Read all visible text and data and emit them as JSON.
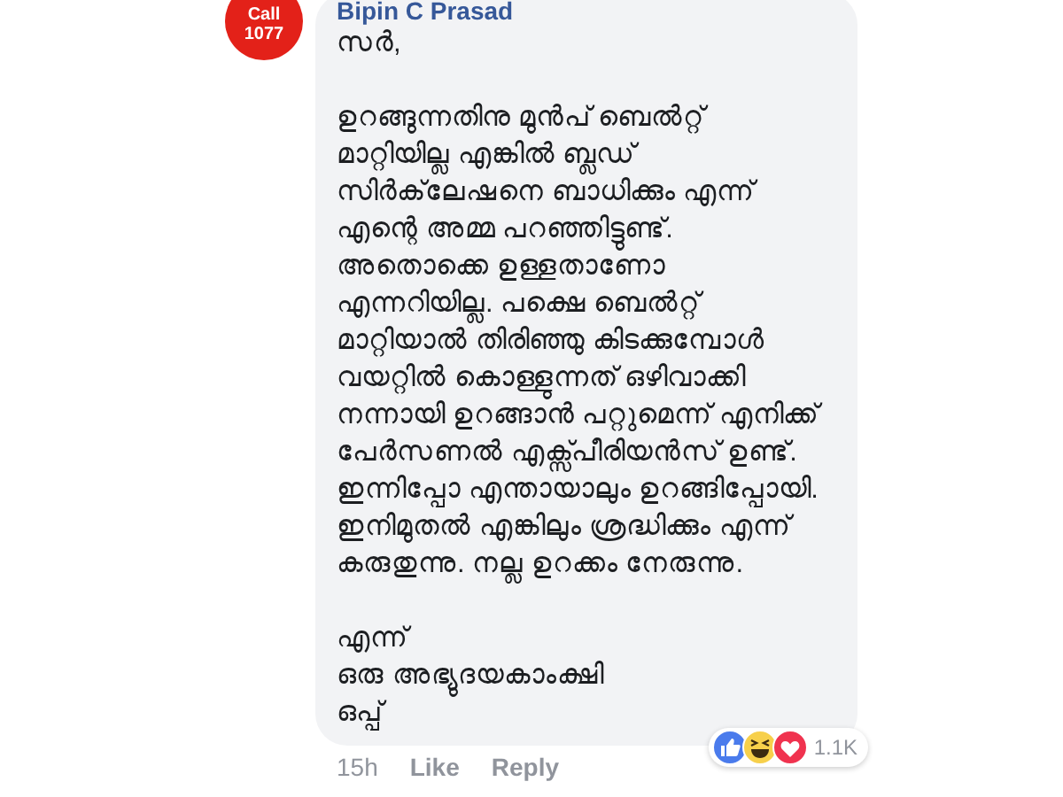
{
  "avatar": {
    "lines": [
      "Call",
      "1077"
    ]
  },
  "comment": {
    "author": "Bipin C Prasad",
    "paragraphs": [
      "സർ,",
      "ഉറങ്ങുന്നതിനു മുൻപ് ബെൽറ്റ്\nമാറ്റിയില്ല എങ്കിൽ ബ്ലഡ്\nസിർക്‌ലേഷനെ ബാധിക്കും എന്ന്\nഎന്റെ അമ്മ പറഞ്ഞിട്ടുണ്ട്.\nഅതൊക്കെ ഉള്ളതാണോ\nഎന്നറിയില്ല. പക്ഷെ ബെൽറ്റ്\nമാറ്റിയാൽ തിരിഞ്ഞു കിടക്കുമ്പോൾ\nവയറ്റിൽ കൊള്ളുന്നത് ഒഴിവാക്കി\nനന്നായി ഉറങ്ങാൻ പറ്റുമെന്ന് എനിക്ക്\nപേർസണൽ എക്സ്പീരിയൻസ് ഉണ്ട്.\nഇന്നിപ്പോ എന്തായാലും ഉറങ്ങിപ്പോയി.\nഇനിമുതൽ എങ്കിലും ശ്രദ്ധിക്കും എന്ന്\nകരുതുന്നു. നല്ല ഉറക്കം നേരുന്നു.",
      "എന്ന്\nഒരു അഭ്യുദയകാംക്ഷി\nഒപ്പ്"
    ],
    "time": "15h",
    "actions": [
      "Like",
      "Reply"
    ],
    "reactions": {
      "count": "1.1K"
    }
  }
}
